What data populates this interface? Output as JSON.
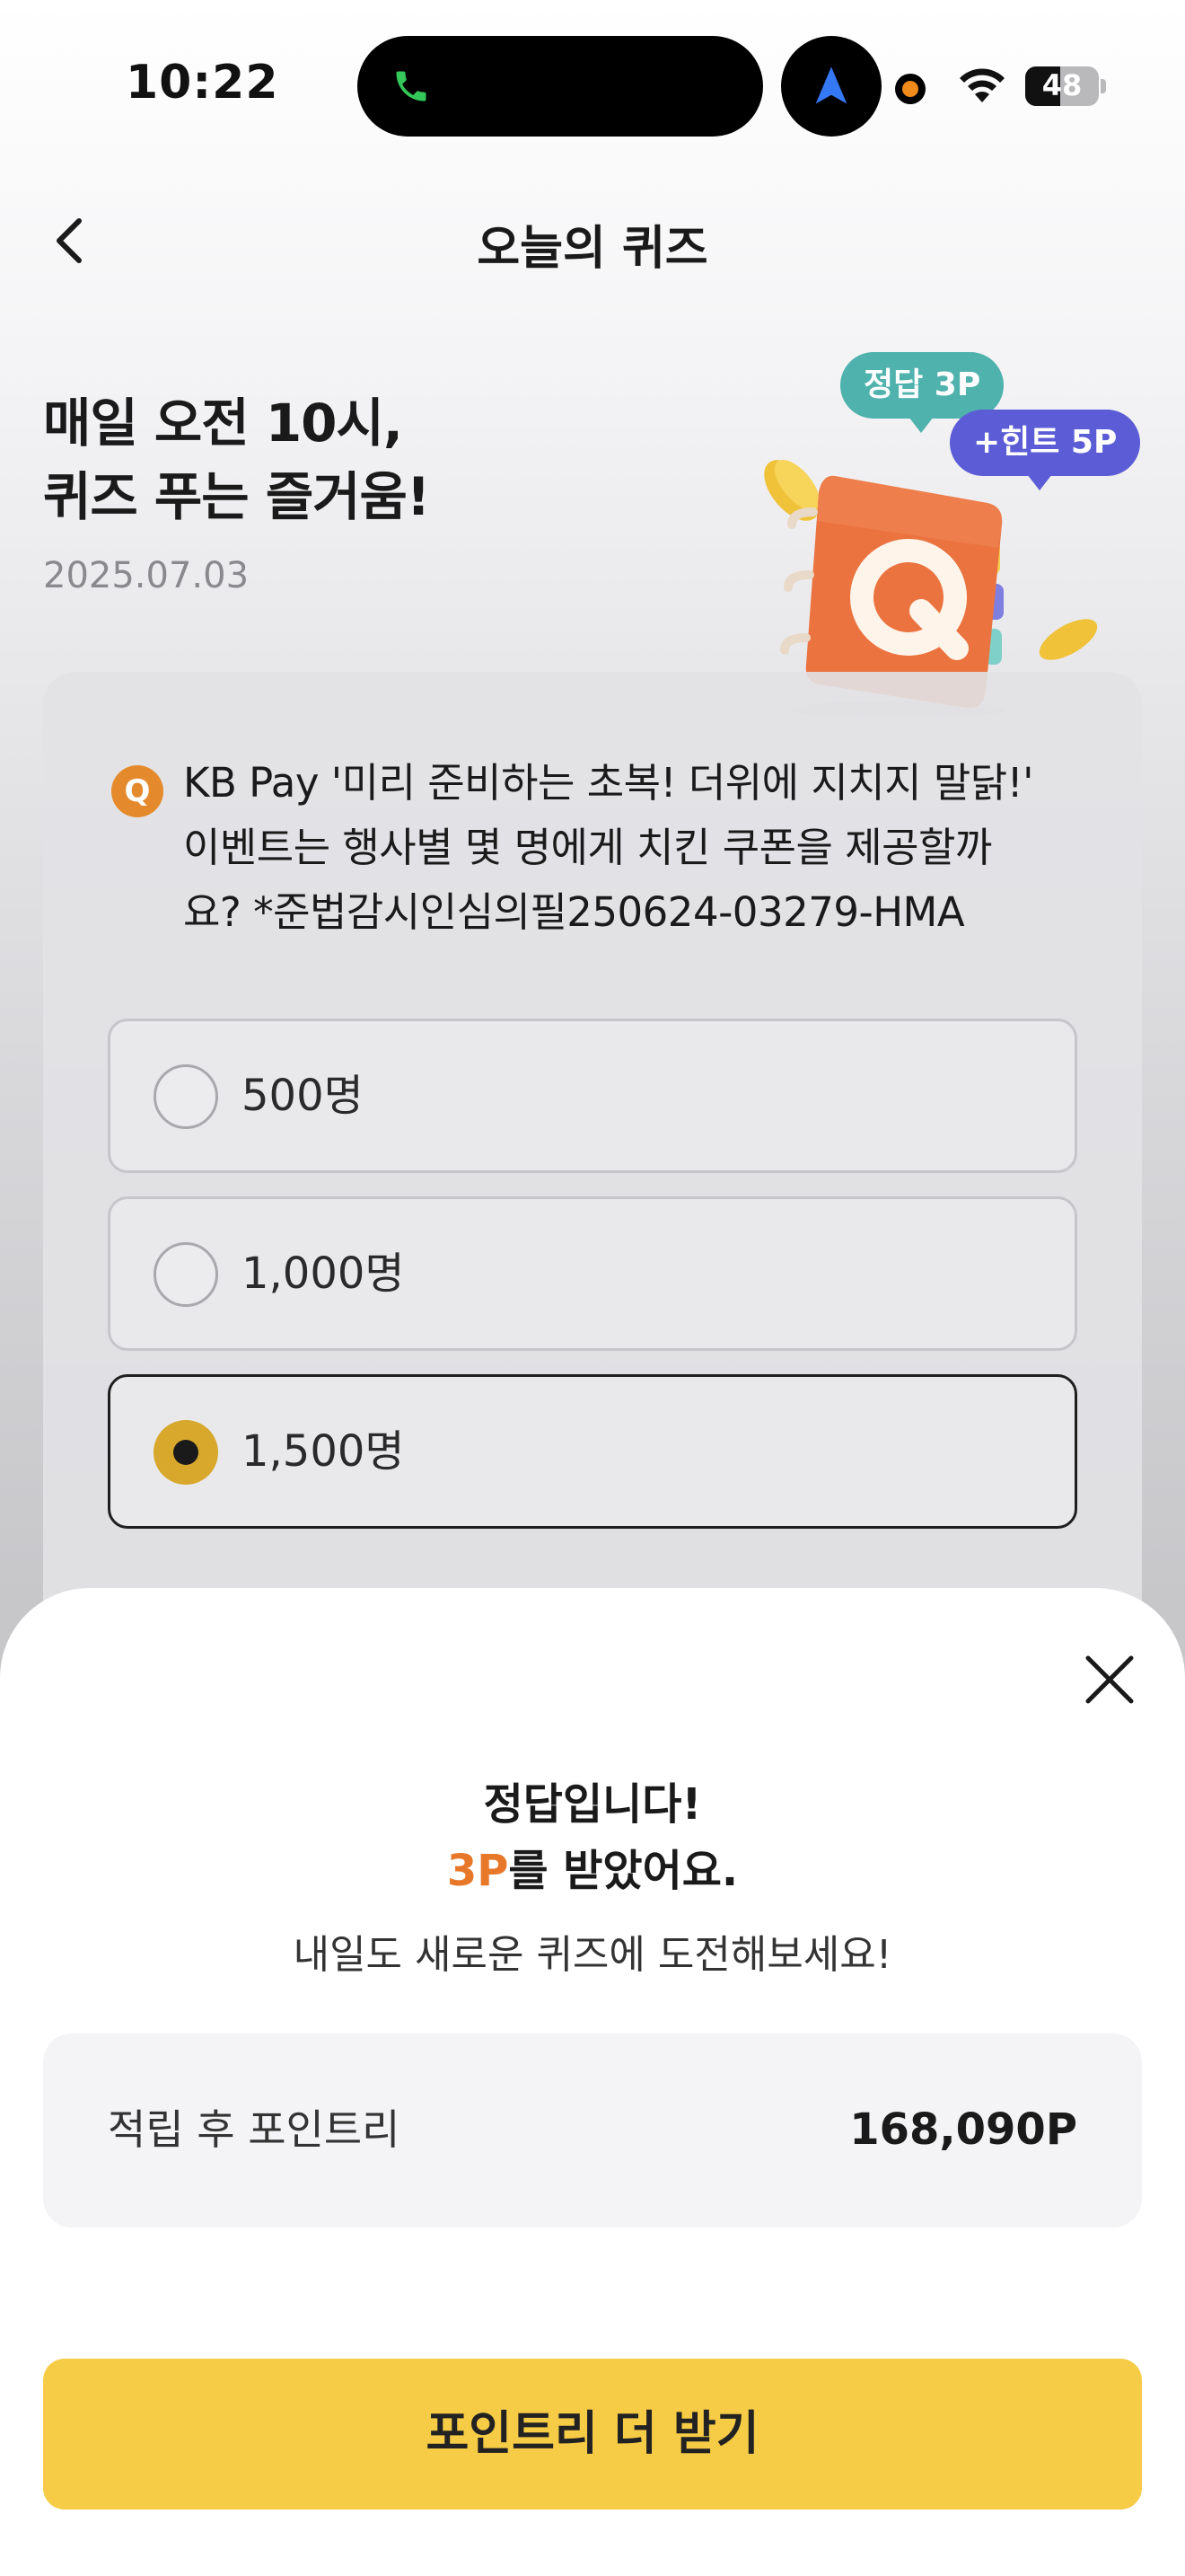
{
  "status_bar": {
    "time": "10:22",
    "battery_level": "48",
    "battery_fraction": 0.48
  },
  "header": {
    "title": "오늘의 퀴즈",
    "back_icon": "chevron-left-icon"
  },
  "hero": {
    "title_line1": "매일 오전 10시,",
    "title_line2": "퀴즈 푸는 즐거움!",
    "date": "2025.07.03",
    "tag_answer": "정답 3P",
    "tag_hint": "+힌트 5P",
    "illustration_letter": "Q"
  },
  "quiz": {
    "badge": "Q",
    "question_line1": "KB Pay '미리 준비하는 초복! 더위에 지치지 말닭!'",
    "question_line2": "이벤트는 행사별 몇 명에게 치킨 쿠폰을 제공할까",
    "question_line3": "요? *준법감시인심의필250624-03279-HMA",
    "options": [
      {
        "label": "500명",
        "selected": false
      },
      {
        "label": "1,000명",
        "selected": false
      },
      {
        "label": "1,500명",
        "selected": true
      }
    ]
  },
  "result_sheet": {
    "title": "정답입니다!",
    "points_earned": "3P",
    "points_suffix": "를 받았어요.",
    "subtitle": "내일도 새로운 퀴즈에 도전해보세요!",
    "balance_label": "적립 후 포인트리",
    "balance_value": "168,090P",
    "cta_label": "포인트리 더 받기",
    "close_icon": "close-icon"
  },
  "colors": {
    "accent_yellow": "#f6cb45",
    "points_orange": "#e7782a",
    "tag_teal": "#4fb2ad",
    "tag_purple": "#5b5cd6",
    "radio_selected": "#d8a82c"
  }
}
